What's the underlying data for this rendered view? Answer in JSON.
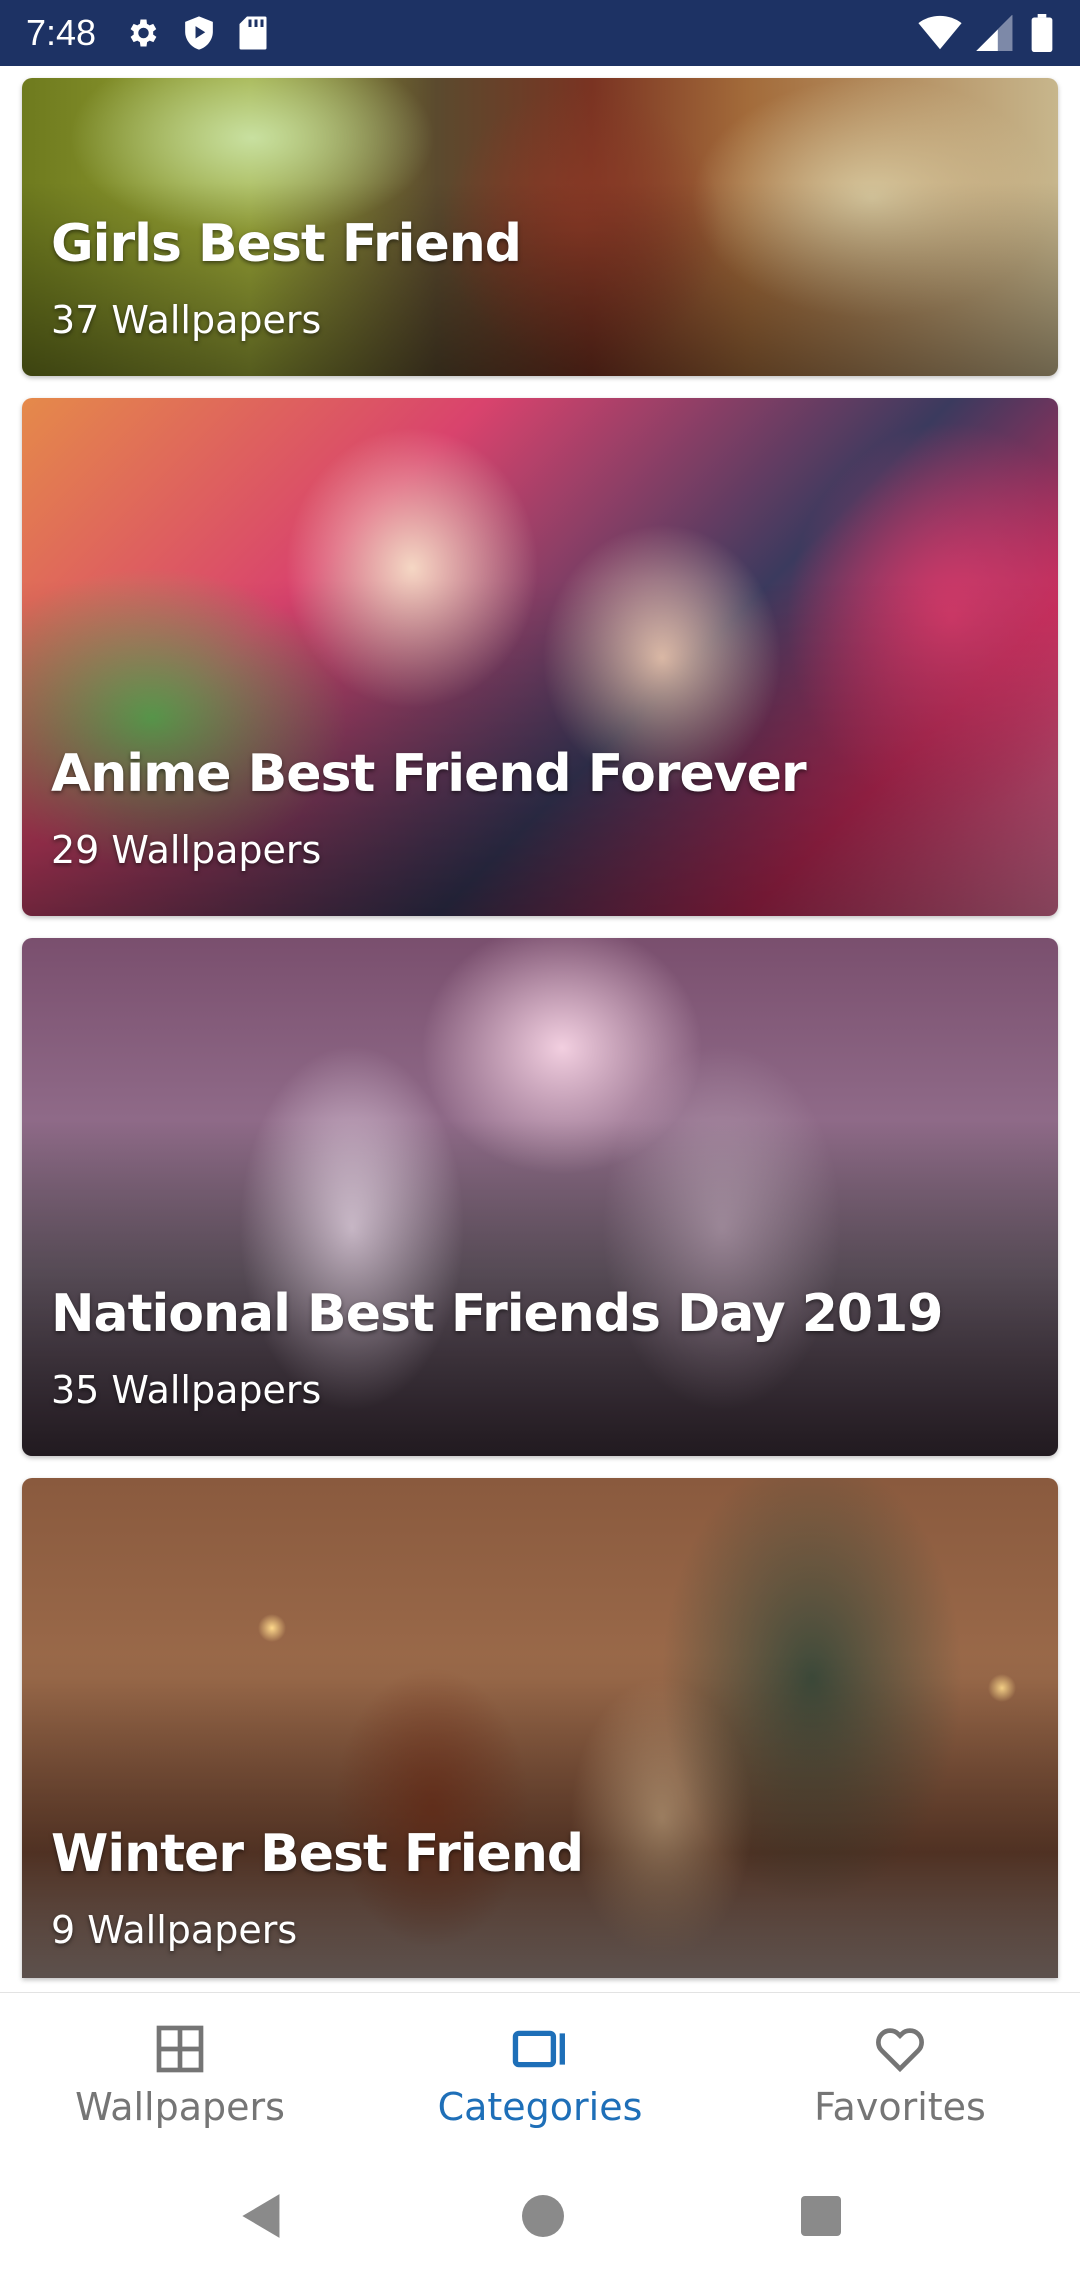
{
  "status_bar": {
    "time": "7:48",
    "left_icons": [
      "gear-icon",
      "play-protect-icon",
      "sd-card-icon"
    ],
    "right_icons": [
      "wifi-icon",
      "signal-icon",
      "battery-icon"
    ]
  },
  "categories": [
    {
      "title": "Girls Best Friend",
      "count": "37 Wallpapers"
    },
    {
      "title": "Anime Best Friend Forever",
      "count": "29 Wallpapers"
    },
    {
      "title": "National Best Friends Day 2019",
      "count": "35 Wallpapers"
    },
    {
      "title": "Winter Best Friend",
      "count": "9 Wallpapers"
    }
  ],
  "bottom_nav": {
    "items": [
      {
        "label": "Wallpapers",
        "icon": "grid-icon",
        "active": false
      },
      {
        "label": "Categories",
        "icon": "categories-icon",
        "active": true
      },
      {
        "label": "Favorites",
        "icon": "heart-icon",
        "active": false
      }
    ],
    "active_color": "#1e6fb8",
    "inactive_color": "#757575"
  },
  "system_nav": [
    "back-icon",
    "home-icon",
    "recents-icon"
  ],
  "colors": {
    "status_bar": "#1d3264",
    "background": "#ffffff"
  }
}
